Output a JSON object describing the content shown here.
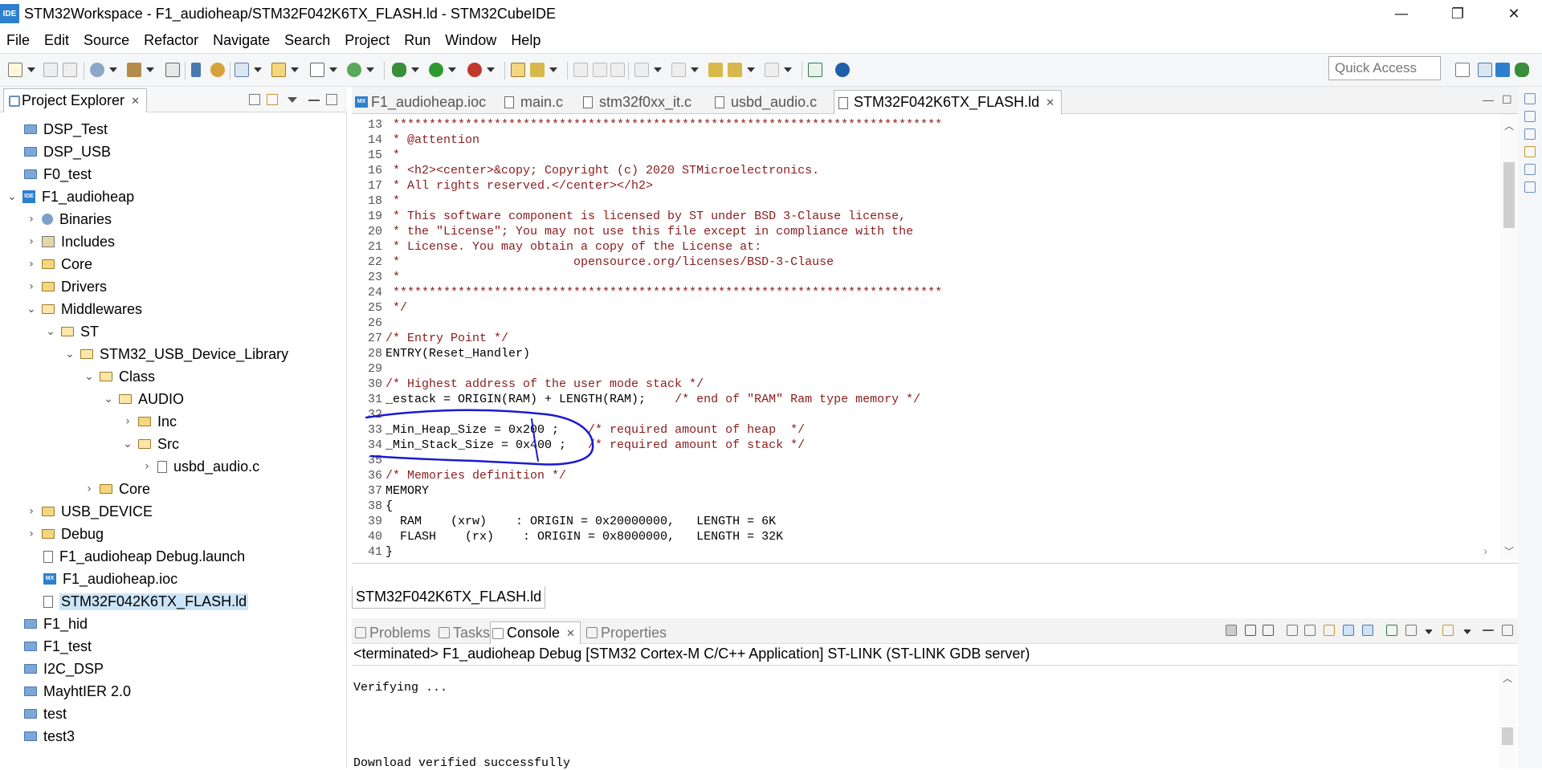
{
  "window": {
    "app_icon": "IDE",
    "title": "STM32Workspace - F1_audioheap/STM32F042K6TX_FLASH.ld - STM32CubeIDE",
    "minimize": "—",
    "restore": "❐",
    "close": "✕"
  },
  "menu": [
    "File",
    "Edit",
    "Source",
    "Refactor",
    "Navigate",
    "Search",
    "Project",
    "Run",
    "Window",
    "Help"
  ],
  "toolbar": {
    "quick_access_placeholder": "Quick Access"
  },
  "project_explorer": {
    "title": "Project Explorer",
    "close": "✕",
    "items": [
      {
        "label": "DSP_Test",
        "chevron": "",
        "icon": "project-icon"
      },
      {
        "label": "DSP_USB",
        "chevron": "",
        "icon": "project-icon"
      },
      {
        "label": "F0_test",
        "chevron": "",
        "icon": "project-icon"
      },
      {
        "label": "F1_audioheap",
        "chevron": "⌄",
        "icon": "ide-project-icon"
      },
      {
        "label": "Binaries",
        "chevron": "›",
        "icon": "binaries-icon"
      },
      {
        "label": "Includes",
        "chevron": "›",
        "icon": "includes-icon"
      },
      {
        "label": "Core",
        "chevron": "›",
        "icon": "folder-icon"
      },
      {
        "label": "Drivers",
        "chevron": "›",
        "icon": "folder-icon"
      },
      {
        "label": "Middlewares",
        "chevron": "⌄",
        "icon": "folder-open-icon"
      },
      {
        "label": "ST",
        "chevron": "⌄",
        "icon": "folder-open-icon"
      },
      {
        "label": "STM32_USB_Device_Library",
        "chevron": "⌄",
        "icon": "folder-open-icon"
      },
      {
        "label": "Class",
        "chevron": "⌄",
        "icon": "folder-open-icon"
      },
      {
        "label": "AUDIO",
        "chevron": "⌄",
        "icon": "folder-open-icon"
      },
      {
        "label": "Inc",
        "chevron": "›",
        "icon": "folder-icon"
      },
      {
        "label": "Src",
        "chevron": "⌄",
        "icon": "folder-open-icon"
      },
      {
        "label": "usbd_audio.c",
        "chevron": "›",
        "icon": "c-file-icon"
      },
      {
        "label": "Core",
        "chevron": "›",
        "icon": "folder-icon"
      },
      {
        "label": "USB_DEVICE",
        "chevron": "›",
        "icon": "folder-icon"
      },
      {
        "label": "Debug",
        "chevron": "›",
        "icon": "folder-icon"
      },
      {
        "label": "F1_audioheap Debug.launch",
        "chevron": "",
        "icon": "launch-file-icon"
      },
      {
        "label": "F1_audioheap.ioc",
        "chevron": "",
        "icon": "mx-file-icon"
      },
      {
        "label": "STM32F042K6TX_FLASH.ld",
        "chevron": "",
        "icon": "ld-file-icon",
        "selected": true
      },
      {
        "label": "F1_hid",
        "chevron": "",
        "icon": "project-icon"
      },
      {
        "label": "F1_test",
        "chevron": "",
        "icon": "project-icon"
      },
      {
        "label": "I2C_DSP",
        "chevron": "",
        "icon": "project-icon"
      },
      {
        "label": "MayhtIER 2.0",
        "chevron": "",
        "icon": "project-icon"
      },
      {
        "label": "test",
        "chevron": "",
        "icon": "project-icon"
      },
      {
        "label": "test3",
        "chevron": "",
        "icon": "project-icon"
      }
    ]
  },
  "editor": {
    "tabs": [
      {
        "label": "F1_audioheap.ioc",
        "icon": "mx-file-icon",
        "active": false
      },
      {
        "label": "main.c",
        "icon": "c-file-icon",
        "active": false
      },
      {
        "label": "stm32f0xx_it.c",
        "icon": "c-file-icon",
        "active": false
      },
      {
        "label": "usbd_audio.c",
        "icon": "c-file-icon",
        "active": false
      },
      {
        "label": "STM32F042K6TX_FLASH.ld",
        "icon": "ld-file-icon",
        "active": true,
        "close": "✕"
      }
    ],
    "lines": [
      {
        "n": "13",
        "t": " ****************************************************************************",
        "c": true
      },
      {
        "n": "14",
        "t": " * @attention",
        "c": true
      },
      {
        "n": "15",
        "t": " *",
        "c": true
      },
      {
        "n": "16",
        "t": " * <h2><center>&copy; Copyright (c) 2020 STMicroelectronics.",
        "c": true
      },
      {
        "n": "17",
        "t": " * All rights reserved.</center></h2>",
        "c": true
      },
      {
        "n": "18",
        "t": " *",
        "c": true
      },
      {
        "n": "19",
        "t": " * This software component is licensed by ST under BSD 3-Clause license,",
        "c": true
      },
      {
        "n": "20",
        "t": " * the \"License\"; You may not use this file except in compliance with the",
        "c": true
      },
      {
        "n": "21",
        "t": " * License. You may obtain a copy of the License at:",
        "c": true
      },
      {
        "n": "22",
        "t": " *                        opensource.org/licenses/BSD-3-Clause",
        "c": true
      },
      {
        "n": "23",
        "t": " *",
        "c": true
      },
      {
        "n": "24",
        "t": " ****************************************************************************",
        "c": true
      },
      {
        "n": "25",
        "t": " */",
        "c": true
      },
      {
        "n": "26",
        "t": "",
        "c": false
      },
      {
        "n": "27",
        "t": "/* Entry Point */",
        "c": true
      },
      {
        "n": "28",
        "t": "ENTRY(Reset_Handler)",
        "c": false
      },
      {
        "n": "29",
        "t": "",
        "c": false
      },
      {
        "n": "30",
        "t": "/* Highest address of the user mode stack */",
        "c": true
      },
      {
        "n": "31",
        "t": "_estack = ORIGIN(RAM) + LENGTH(RAM);",
        "c": false,
        "tail": "    /* end of \"RAM\" Ram type memory */"
      },
      {
        "n": "32",
        "t": "",
        "c": false
      },
      {
        "n": "33",
        "t": "_Min_Heap_Size = 0x200 ;",
        "c": false,
        "tail": "    /* required amount of heap  */"
      },
      {
        "n": "34",
        "t": "_Min_Stack_Size = 0x400 ;",
        "c": false,
        "tail": "   /* required amount of stack */"
      },
      {
        "n": "35",
        "t": "",
        "c": false
      },
      {
        "n": "36",
        "t": "/* Memories definition */",
        "c": true
      },
      {
        "n": "37",
        "t": "MEMORY",
        "c": false
      },
      {
        "n": "38",
        "t": "{",
        "c": false
      },
      {
        "n": "39",
        "t": "  RAM    (xrw)    : ORIGIN = 0x20000000,   LENGTH = 6K",
        "c": false
      },
      {
        "n": "40",
        "t": "  FLASH    (rx)    : ORIGIN = 0x8000000,   LENGTH = 32K",
        "c": false
      },
      {
        "n": "41",
        "t": "}",
        "c": false
      }
    ],
    "bottom_tab": "STM32F042K6TX_FLASH.ld"
  },
  "console": {
    "tabs": [
      {
        "label": "Problems",
        "active": false
      },
      {
        "label": "Tasks",
        "active": false
      },
      {
        "label": "Console",
        "active": true,
        "close": "✕"
      },
      {
        "label": "Properties",
        "active": false
      }
    ],
    "status": "<terminated> F1_audioheap Debug [STM32 Cortex-M C/C++ Application] ST-LINK (ST-LINK GDB server)",
    "lines": [
      "Verifying ...",
      "",
      "",
      "",
      "Download verified successfully"
    ]
  },
  "colors": {
    "comment": "#8a1c1c",
    "annotation": "#1a1ad0",
    "selection": "#cce4f7"
  }
}
